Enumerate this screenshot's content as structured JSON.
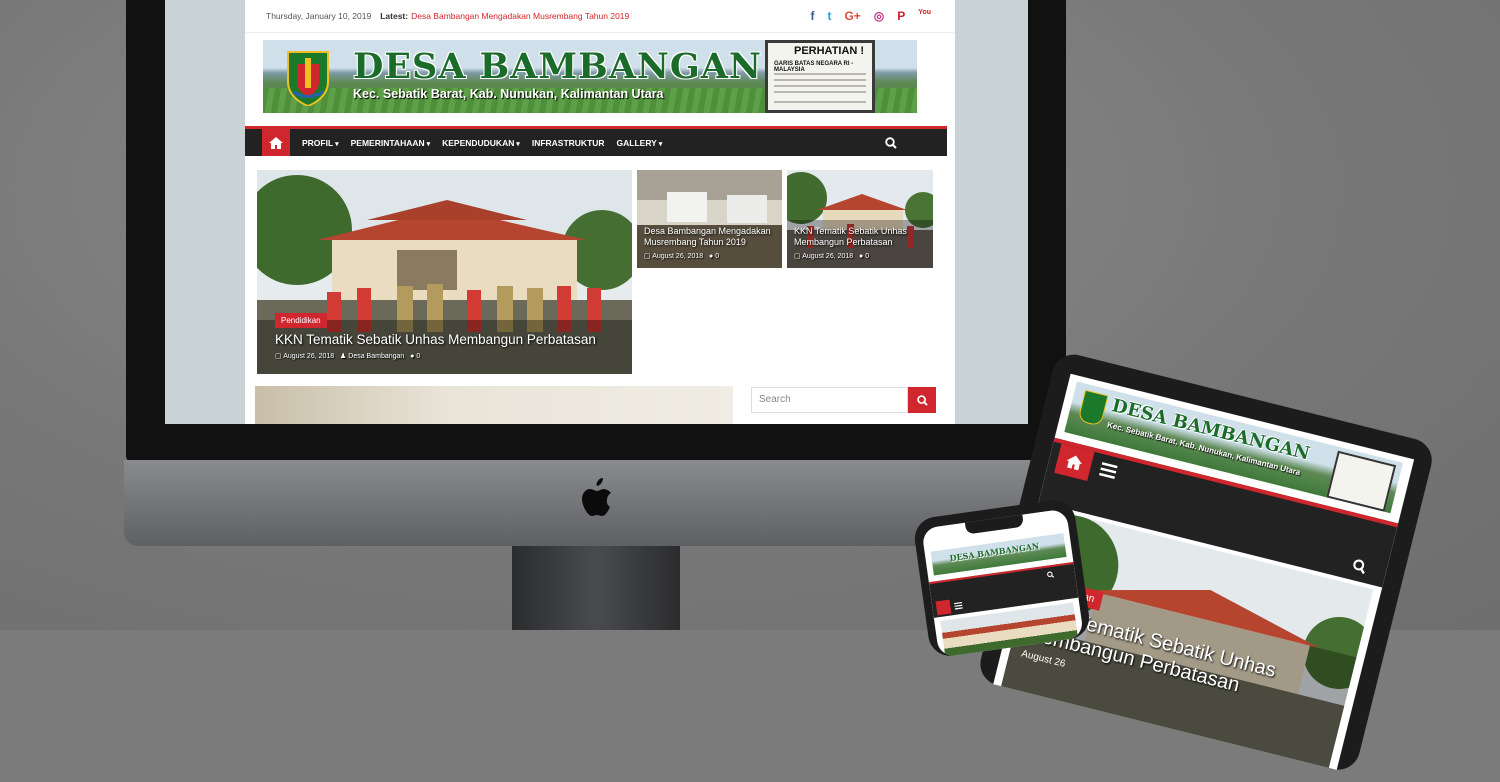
{
  "topbar": {
    "date": "Thursday, January 10, 2019",
    "latest_label": "Latest:",
    "latest_link": "Desa Bambangan Mengadakan Musrembang Tahun 2019",
    "socials": [
      {
        "icon": "facebook-icon",
        "glyph": "f",
        "color": "#3b5998"
      },
      {
        "icon": "twitter-icon",
        "glyph": "t",
        "color": "#1da1f2"
      },
      {
        "icon": "google-plus-icon",
        "glyph": "G+",
        "color": "#dd4b39"
      },
      {
        "icon": "instagram-icon",
        "glyph": "◎",
        "color": "#c13584"
      },
      {
        "icon": "pinterest-icon",
        "glyph": "P",
        "color": "#cb2027"
      },
      {
        "icon": "youtube-icon",
        "glyph": "You",
        "color": "#cd201f"
      }
    ]
  },
  "banner": {
    "title": "DESA BAMBANGAN",
    "subtitle": "Kec. Sebatik Barat, Kab. Nunukan, Kalimantan Utara",
    "sign_title": "PERHATIAN !",
    "sign_text": "GARIS BATAS NEGARA RI - MALAYSIA"
  },
  "nav": {
    "items": [
      "PROFIL",
      "PEMERINTAHAAN",
      "KEPENDUDUKAN",
      "INFRASTRUKTUR",
      "GALLERY"
    ],
    "has_dropdown": [
      true,
      true,
      true,
      false,
      true
    ]
  },
  "featured": {
    "main": {
      "category": "Pendidikan",
      "title": "KKN Tematik Sebatik Unhas Membangun Perbatasan",
      "date": "August 26, 2018",
      "author": "Desa Bambangan",
      "comments": "0"
    },
    "side": [
      {
        "title": "Desa Bambangan Mengadakan Musrembang Tahun 2019",
        "date": "August 26, 2018",
        "comments": "0"
      },
      {
        "title": "KKN Tematik Sebatik Unhas Membangun Perbatasan",
        "date": "August 26, 2018",
        "comments": "0"
      }
    ]
  },
  "sidebar": {
    "search_placeholder": "Search"
  },
  "tablet": {
    "banner_title": "DESA BAMBANGAN",
    "banner_subtitle": "Kec. Sebatik Barat, Kab. Nunukan, Kalimantan Utara",
    "category": "Pendidikan",
    "headline": "KKN Tematik Sebatik Unhas Membangun Perbatasan",
    "date": "August 26"
  },
  "phone": {
    "banner_title": "DESA BAMBANGAN"
  },
  "colors": {
    "accent": "#d0262d",
    "nav_bg": "#222222",
    "brand_green": "#1b6b2a"
  }
}
